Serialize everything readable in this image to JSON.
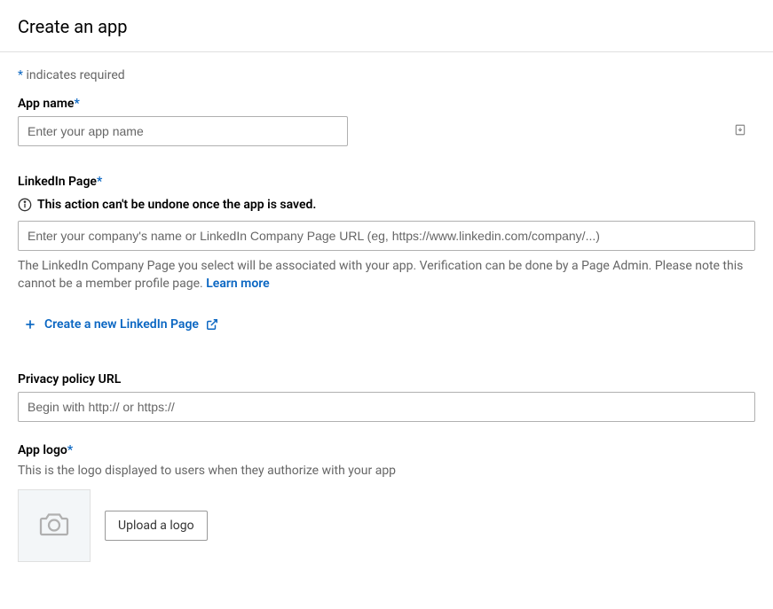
{
  "header": {
    "title": "Create an app"
  },
  "requiredNote": {
    "asterisk": "*",
    "text": " indicates required"
  },
  "appName": {
    "label": "App name",
    "placeholder": "Enter your app name"
  },
  "linkedinPage": {
    "label": "LinkedIn Page",
    "warning": "This action can't be undone once the app is saved.",
    "placeholder": "Enter your company's name or LinkedIn Company Page URL (eg, https://www.linkedin.com/company/...)",
    "helper": "The LinkedIn Company Page you select will be associated with your app. Verification can be done by a Page Admin. Please note this cannot be a member profile page. ",
    "learnMore": "Learn more",
    "createNew": "Create a new LinkedIn Page"
  },
  "privacyPolicy": {
    "label": "Privacy policy URL",
    "placeholder": "Begin with http:// or https://"
  },
  "appLogo": {
    "label": "App logo",
    "helper": "This is the logo displayed to users when they authorize with your app",
    "uploadButton": "Upload a logo"
  }
}
